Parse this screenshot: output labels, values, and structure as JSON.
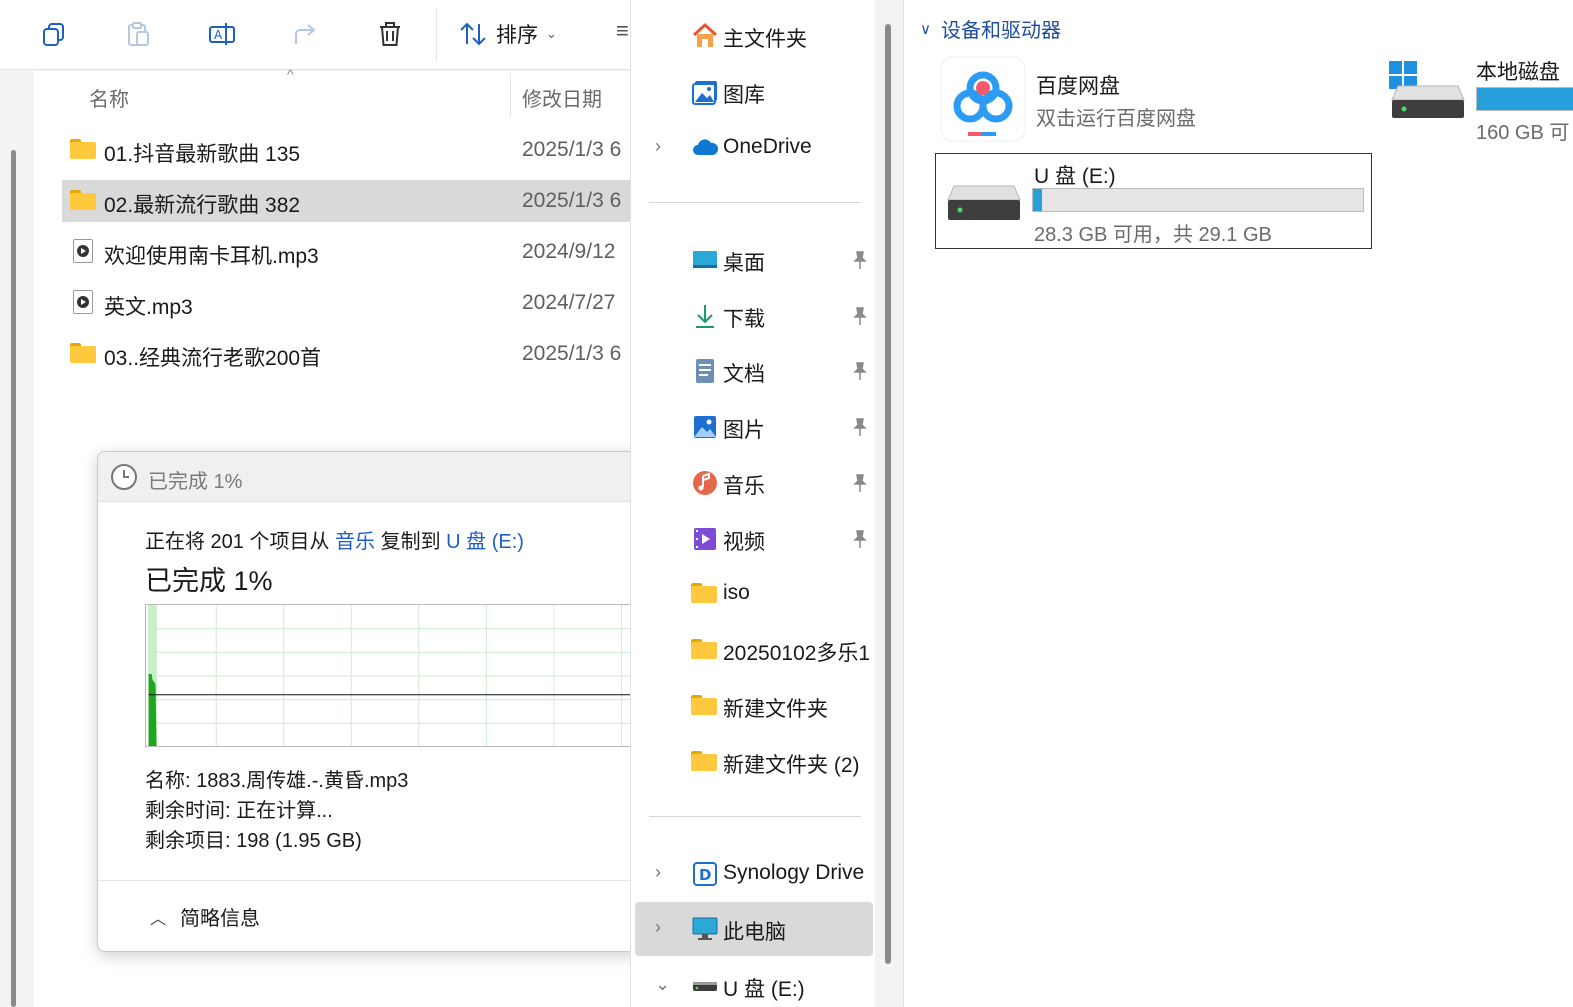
{
  "toolbar": {
    "sort_label": "排序",
    "buttons": [
      "copy-icon",
      "paste-icon",
      "rename-icon",
      "share-icon",
      "delete-icon"
    ]
  },
  "file_list": {
    "columns": {
      "name": "名称",
      "date": "修改日期"
    },
    "rows": [
      {
        "name": "01.抖音最新歌曲 135",
        "date": "2025/1/3 6",
        "type": "folder",
        "selected": false
      },
      {
        "name": "02.最新流行歌曲 382",
        "date": "2025/1/3 6",
        "type": "folder",
        "selected": true
      },
      {
        "name": "欢迎使用南卡耳机.mp3",
        "date": "2024/9/12",
        "type": "mp3",
        "selected": false
      },
      {
        "name": "英文.mp3",
        "date": "2024/7/27",
        "type": "mp3",
        "selected": false
      },
      {
        "name": "03..经典流行老歌200首",
        "date": "2025/1/3 6",
        "type": "folder",
        "selected": false
      }
    ]
  },
  "copy_dialog": {
    "title": "已完成 1%",
    "desc_prefix": "正在将 201 个项目从",
    "source": "音乐",
    "desc_mid": "复制到",
    "destination": "U 盘 (E:)",
    "percent_label": "已完成 1%",
    "progress_percent": 1,
    "name_label": "名称:",
    "name_value": "1883.周传雄.-.黄昏.mp3",
    "time_label": "剩余时间:",
    "time_value": "正在计算...",
    "items_label": "剩余项目:",
    "items_value": "198 (1.95 GB)",
    "footer_label": "简略信息"
  },
  "nav": {
    "home": "主文件夹",
    "gallery": "图库",
    "onedrive": "OneDrive",
    "desktop": "桌面",
    "downloads": "下载",
    "documents": "文档",
    "pictures": "图片",
    "music": "音乐",
    "videos": "视频",
    "iso": "iso",
    "folder_2025": "20250102多乐1",
    "new_folder": "新建文件夹",
    "new_folder_2": "新建文件夹 (2)",
    "synology": "Synology Drive",
    "this_pc": "此电脑",
    "usb": "U 盘 (E:)"
  },
  "content": {
    "section": "设备和驱动器",
    "baidu": {
      "title": "百度网盘",
      "subtitle": "双击运行百度网盘"
    },
    "local_disk": {
      "title": "本地磁盘",
      "free": "160 GB 可",
      "used_fraction": 0.9
    },
    "usb_drive": {
      "title": "U 盘 (E:)",
      "free": "28.3 GB 可用，共 29.1 GB",
      "used_fraction": 0.027
    }
  },
  "colors": {
    "accent": "#26a0da",
    "link": "#1f5fbf",
    "folder": "#ffc83d",
    "graph_green": "#1fa51f"
  }
}
